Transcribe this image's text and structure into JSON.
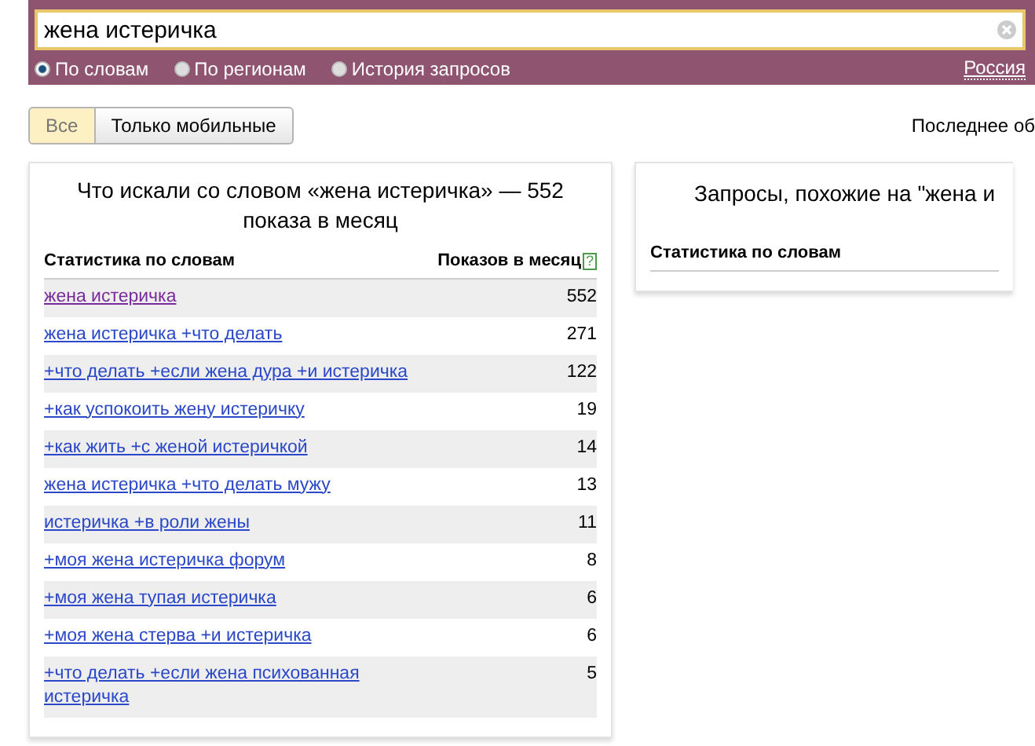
{
  "search": {
    "value": "жена истеричка"
  },
  "modes": [
    {
      "label": "По словам",
      "selected": true
    },
    {
      "label": "По регионам",
      "selected": false
    },
    {
      "label": "История запросов",
      "selected": false
    }
  ],
  "region": "Россия",
  "filters": [
    {
      "label": "Все",
      "selected": true
    },
    {
      "label": "Только мобильные",
      "selected": false
    }
  ],
  "last_update": "Последнее об",
  "left_panel": {
    "title": "Что искали со словом «жена истеричка» — 552 показа в месяц",
    "columns": [
      "Статистика по словам",
      "Показов в месяц"
    ],
    "help": "?",
    "rows": [
      {
        "phrase": "жена истеричка",
        "count": "552",
        "visited": true
      },
      {
        "phrase": "жена истеричка +что делать",
        "count": "271",
        "visited": false
      },
      {
        "phrase": "+что делать +если жена дура +и истеричка",
        "count": "122",
        "visited": false
      },
      {
        "phrase": "+как успокоить жену истеричку",
        "count": "19",
        "visited": false
      },
      {
        "phrase": "+как жить +с женой истеричкой",
        "count": "14",
        "visited": false
      },
      {
        "phrase": "жена истеричка +что делать мужу",
        "count": "13",
        "visited": false
      },
      {
        "phrase": "истеричка +в роли жены",
        "count": "11",
        "visited": false
      },
      {
        "phrase": "+моя жена истеричка форум",
        "count": "8",
        "visited": false
      },
      {
        "phrase": "+моя жена тупая истеричка",
        "count": "6",
        "visited": false
      },
      {
        "phrase": "+моя жена стерва +и истеричка",
        "count": "6",
        "visited": false
      },
      {
        "phrase": "+что делать +если жена психованная истеричка",
        "count": "5",
        "visited": false
      }
    ]
  },
  "right_panel": {
    "title": "Запросы, похожие на \"жена и",
    "columns": [
      "Статистика по словам"
    ]
  }
}
